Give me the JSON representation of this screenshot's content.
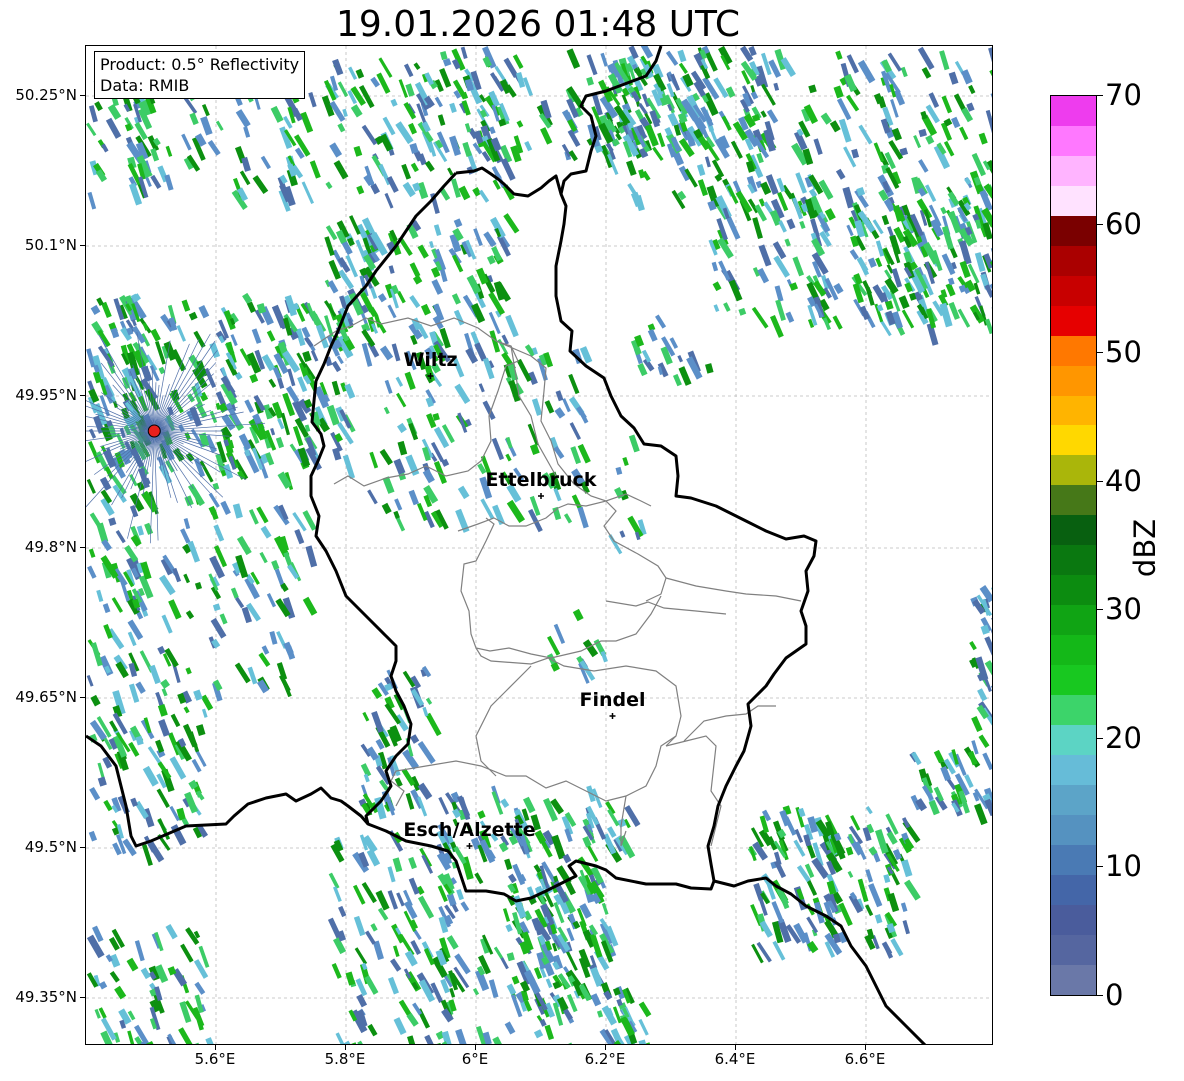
{
  "title": "19.01.2026 01:48 UTC",
  "info": {
    "product": "Product: 0.5° Reflectivity",
    "source": "Data: RMIB"
  },
  "lat_ticks": [
    "50.25°N",
    "50.1°N",
    "49.95°N",
    "49.8°N",
    "49.65°N",
    "49.5°N",
    "49.35°N"
  ],
  "lon_ticks": [
    "5.6°E",
    "5.8°E",
    "6°E",
    "6.2°E",
    "6.4°E",
    "6.6°E"
  ],
  "cities": [
    {
      "name": "Wiltz",
      "lat": 49.97,
      "lon": 5.93
    },
    {
      "name": "Ettelbruck",
      "lat": 49.85,
      "lon": 6.1
    },
    {
      "name": "Findel",
      "lat": 49.63,
      "lon": 6.21
    },
    {
      "name": "Esch/Alzette",
      "lat": 49.5,
      "lon": 5.99
    }
  ],
  "radar_site": {
    "lat": 49.915,
    "lon": 5.505,
    "color": "#e8201c"
  },
  "colorbar": {
    "label": "dBZ",
    "ticks": [
      "0",
      "10",
      "20",
      "30",
      "40",
      "50",
      "60",
      "70"
    ],
    "colors": [
      "#6a78a8",
      "#5566a0",
      "#4a5c9c",
      "#4466a8",
      "#4a7ab4",
      "#5592c0",
      "#5ca4c8",
      "#66bcd8",
      "#5cd4c4",
      "#3cd46a",
      "#18c820",
      "#14b818",
      "#10a414",
      "#0c8c10",
      "#0a7810",
      "#086010",
      "#467818",
      "#aab60a",
      "#ffd800",
      "#ffb400",
      "#ff9600",
      "#ff7800",
      "#e60000",
      "#c80000",
      "#aa0000",
      "#7a0000",
      "#ffe2ff",
      "#ffb4ff",
      "#ff78ff",
      "#ee3cee"
    ]
  },
  "echo_colors": [
    "#4f6fa8",
    "#5b8fc8",
    "#66c0d8",
    "#3ccc66",
    "#1cb81c",
    "#0c9010"
  ]
}
